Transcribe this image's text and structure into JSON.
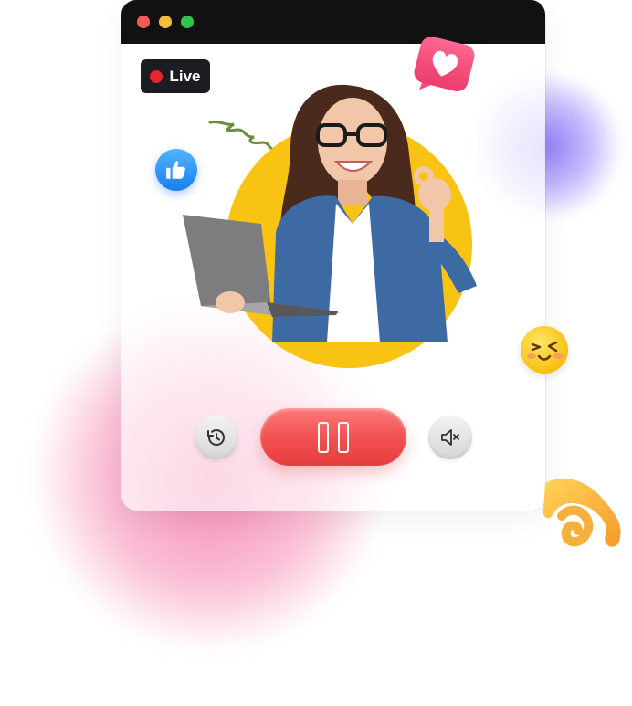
{
  "window": {
    "title_buttons": [
      "close",
      "minimize",
      "zoom"
    ],
    "live_badge": {
      "label": "Live",
      "status_color": "#e8262a"
    }
  },
  "controls": {
    "history": {
      "icon": "history-icon"
    },
    "pause": {
      "icon": "pause-icon",
      "color": "#f14f4f"
    },
    "mute": {
      "icon": "volume-mute-icon"
    }
  },
  "decorations": {
    "like": "thumbs-up-icon",
    "heart": "heart-icon",
    "emoji": "wink-emoji-icon",
    "shape": "swirl-shape"
  },
  "colors": {
    "accent_red": "#f14f4f",
    "hero_circle": "#f8c313",
    "titlebar": "#111111"
  }
}
